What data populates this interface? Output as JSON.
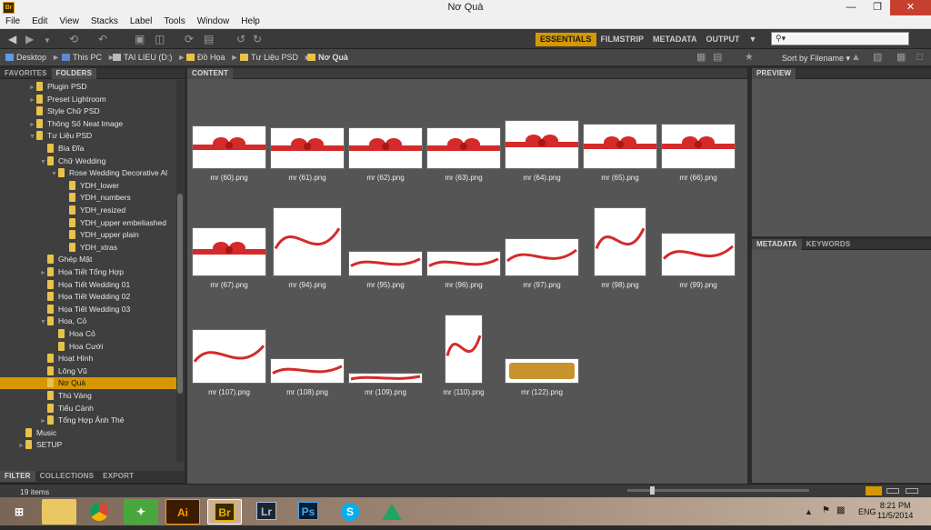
{
  "window": {
    "title": "Nơ Quà"
  },
  "app_icon": "Br",
  "menu": [
    "File",
    "Edit",
    "View",
    "Stacks",
    "Label",
    "Tools",
    "Window",
    "Help"
  ],
  "workspaces": [
    "ESSENTIALS",
    "FILMSTRIP",
    "METADATA",
    "OUTPUT"
  ],
  "search": {
    "placeholder": ""
  },
  "breadcrumb": [
    "Desktop",
    "This PC",
    "TAI LIEU (D:)",
    "Đồ Họa",
    "Tư Liệu PSD",
    "Nơ Quà"
  ],
  "sort_label": "Sort by Filename",
  "left_tabs": [
    "FAVORITES",
    "FOLDERS"
  ],
  "folders": [
    {
      "label": "Plugin PSD"
    },
    {
      "label": "Preset Lightroom"
    },
    {
      "label": "Style Chữ PSD"
    },
    {
      "label": "Thông Số Neat Image"
    },
    {
      "label": "Tư Liệu PSD"
    },
    {
      "label": "Bìa Đĩa"
    },
    {
      "label": "Chữ Wedding"
    },
    {
      "label": "Rose Wedding Decorative Al"
    },
    {
      "label": "YDH_lower"
    },
    {
      "label": "YDH_numbers"
    },
    {
      "label": "YDH_resized"
    },
    {
      "label": "YDH_upper embeliashed"
    },
    {
      "label": "YDH_upper plain"
    },
    {
      "label": "YDH_xtras"
    },
    {
      "label": "Ghép Mặt"
    },
    {
      "label": "Họa Tiết Tổng Hợp"
    },
    {
      "label": "Họa Tiết Wedding 01"
    },
    {
      "label": "Họa Tiết Wedding 02"
    },
    {
      "label": "Họa Tiết Wedding 03"
    },
    {
      "label": "Hoa, Cỏ"
    },
    {
      "label": "Hoa Cỏ"
    },
    {
      "label": "Hoa Cưới"
    },
    {
      "label": "Hoạt Hình"
    },
    {
      "label": "Lông Vũ"
    },
    {
      "label": "Nơ Quà"
    },
    {
      "label": "Thú Vàng"
    },
    {
      "label": "Tiểu Cảnh"
    },
    {
      "label": "Tổng Hợp Ảnh Thẻ"
    },
    {
      "label": "Music"
    },
    {
      "label": "SETUP"
    }
  ],
  "bottom_tabs": [
    "FILTER",
    "COLLECTIONS",
    "EXPORT"
  ],
  "content_tab": "CONTENT",
  "thumbnails": [
    {
      "name": "mr (60).png"
    },
    {
      "name": "mr (61).png"
    },
    {
      "name": "mr (62).png"
    },
    {
      "name": "mr (63).png"
    },
    {
      "name": "mr (64).png"
    },
    {
      "name": "mr (65).png"
    },
    {
      "name": "mr (66).png"
    },
    {
      "name": "mr (67).png"
    },
    {
      "name": "mr (94).png"
    },
    {
      "name": "mr (95).png"
    },
    {
      "name": "mr (96).png"
    },
    {
      "name": "mr (97).png"
    },
    {
      "name": "mr (98).png"
    },
    {
      "name": "mr (99).png"
    },
    {
      "name": "mr (107).png"
    },
    {
      "name": "mr (108).png"
    },
    {
      "name": "mr (109).png"
    },
    {
      "name": "mr (110).png"
    },
    {
      "name": "mr (122).png"
    }
  ],
  "preview_tab": "PREVIEW",
  "meta_tabs": [
    "METADATA",
    "KEYWORDS"
  ],
  "status": {
    "items": "19 items"
  },
  "taskbar_apps": [
    "Ai",
    "Br",
    "Lr",
    "Ps"
  ],
  "clock": {
    "time": "8:21 PM",
    "date": "11/5/2014",
    "lang": "ENG"
  },
  "colors": {
    "accent": "#d69700",
    "ribbon": "#d42a2a"
  }
}
